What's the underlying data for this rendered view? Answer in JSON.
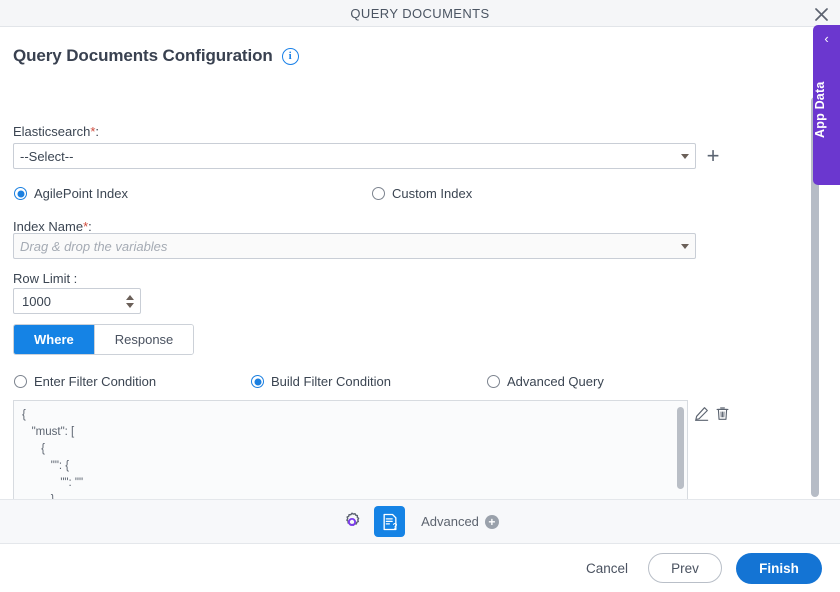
{
  "window": {
    "title": "QUERY DOCUMENTS",
    "close_icon": "close-icon"
  },
  "page": {
    "heading": "Query Documents Configuration",
    "info_icon": "i"
  },
  "fields": {
    "elasticsearch": {
      "label": "Elasticsearch",
      "required_mark": "*",
      "colon": ":",
      "value": "--Select--",
      "add_icon": "+"
    },
    "index_source": {
      "options": [
        {
          "label": "AgilePoint Index",
          "selected": true
        },
        {
          "label": "Custom Index",
          "selected": false
        }
      ]
    },
    "index_name": {
      "label": "Index Name",
      "required_mark": "*",
      "colon": ":",
      "placeholder": "Drag & drop the variables",
      "value": ""
    },
    "row_limit": {
      "label": "Row Limit :",
      "value": "1000"
    }
  },
  "tabs": [
    {
      "label": "Where",
      "active": true
    },
    {
      "label": "Response",
      "active": false
    }
  ],
  "filter_modes": [
    {
      "label": "Enter Filter Condition",
      "selected": false
    },
    {
      "label": "Build Filter Condition",
      "selected": true
    },
    {
      "label": "Advanced Query",
      "selected": false
    }
  ],
  "editor": {
    "content": "{\n   \"must\": [\n      {\n         \"\": {\n            \"\": \"\"\n         }\n      }\n   ]\n}",
    "edit_icon": "pencil-icon",
    "delete_icon": "trash-icon"
  },
  "app_data_tab": {
    "label": "App Data",
    "chevron": "‹"
  },
  "toolbar": {
    "gear_icon": "gear-icon",
    "doc_help_icon": "document-question-icon",
    "advanced_label": "Advanced",
    "advanced_plus": "+"
  },
  "actions": {
    "cancel": "Cancel",
    "prev": "Prev",
    "finish": "Finish"
  },
  "colors": {
    "accent_blue": "#1583e5",
    "primary_blue": "#1474d4",
    "purple": "#6b37cf",
    "required_red": "#cf4b3c",
    "gear_purple": "#7c3aed"
  }
}
